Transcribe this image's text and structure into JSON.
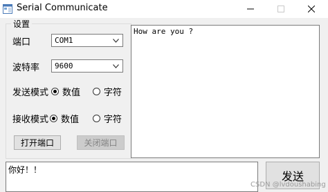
{
  "window": {
    "title": "Serial Communicate",
    "controls": {
      "minimize_icon": "minimize-icon",
      "maximize_icon": "maximize-icon",
      "close_icon": "close-icon"
    }
  },
  "settings": {
    "group_title": "设置",
    "port_label": "端口",
    "port_value": "COM1",
    "baud_label": "波特率",
    "baud_value": "9600",
    "send_mode_label": "发送模式",
    "send_mode_options": [
      {
        "label": "数值",
        "selected": true
      },
      {
        "label": "字符",
        "selected": false
      }
    ],
    "receive_mode_label": "接收模式",
    "receive_mode_options": [
      {
        "label": "数值",
        "selected": true
      },
      {
        "label": "字符",
        "selected": false
      }
    ],
    "open_port_label": "打开端口",
    "close_port_label": "关闭端口"
  },
  "receive_area": {
    "text": "How are you ?"
  },
  "send_area": {
    "text": "你好！！",
    "send_button_label": "发送"
  },
  "watermark": "CSDN @lvdoushabing"
}
